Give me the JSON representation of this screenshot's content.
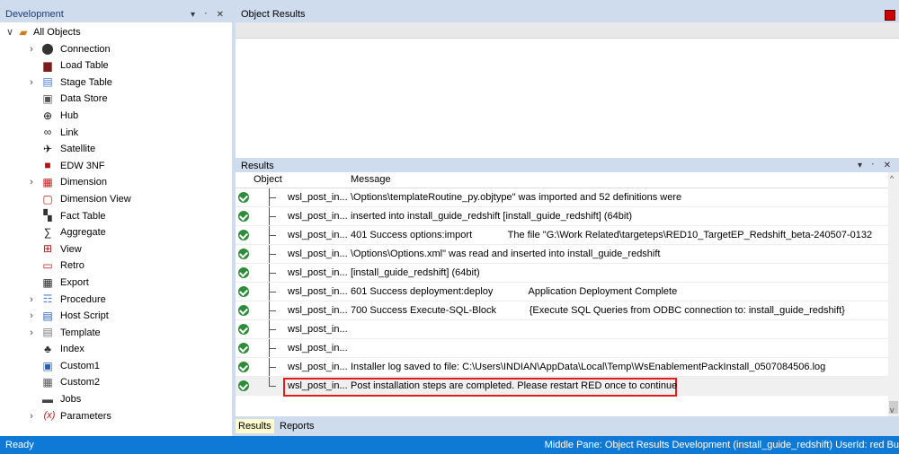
{
  "left_panel": {
    "title": "Development",
    "pin": "▾ ᛫ ✕",
    "root": "All Objects",
    "items": [
      {
        "label": "Connection",
        "arrow": ">",
        "icon": "connection-icon",
        "glyph": "⬤",
        "color": "#333"
      },
      {
        "label": "Load Table",
        "arrow": "",
        "icon": "load-table-icon",
        "glyph": "▆",
        "color": "#7a1d1d"
      },
      {
        "label": "Stage Table",
        "arrow": ">",
        "icon": "stage-table-icon",
        "glyph": "▤",
        "color": "#4b7bd1"
      },
      {
        "label": "Data Store",
        "arrow": "",
        "icon": "data-store-icon",
        "glyph": "▣",
        "color": "#555"
      },
      {
        "label": "Hub",
        "arrow": "",
        "icon": "hub-icon",
        "glyph": "⊕",
        "color": "#111"
      },
      {
        "label": "Link",
        "arrow": "",
        "icon": "link-icon",
        "glyph": "∞",
        "color": "#222"
      },
      {
        "label": "Satellite",
        "arrow": "",
        "icon": "satellite-icon",
        "glyph": "✈",
        "color": "#111"
      },
      {
        "label": "EDW 3NF",
        "arrow": "",
        "icon": "edw-icon",
        "glyph": "■",
        "color": "#b01818"
      },
      {
        "label": "Dimension",
        "arrow": ">",
        "icon": "dimension-icon",
        "glyph": "▦",
        "color": "#c01818"
      },
      {
        "label": "Dimension View",
        "arrow": "",
        "icon": "dimension-view-icon",
        "glyph": "▢",
        "color": "#c01818"
      },
      {
        "label": "Fact Table",
        "arrow": "",
        "icon": "fact-table-icon",
        "glyph": "▚",
        "color": "#333"
      },
      {
        "label": "Aggregate",
        "arrow": "",
        "icon": "aggregate-icon",
        "glyph": "∑",
        "color": "#111"
      },
      {
        "label": "View",
        "arrow": "",
        "icon": "view-icon",
        "glyph": "⊞",
        "color": "#b01818"
      },
      {
        "label": "Retro",
        "arrow": "",
        "icon": "retro-icon",
        "glyph": "▭",
        "color": "#b01818"
      },
      {
        "label": "Export",
        "arrow": "",
        "icon": "export-icon",
        "glyph": "▦",
        "color": "#222"
      },
      {
        "label": "Procedure",
        "arrow": ">",
        "icon": "procedure-icon",
        "glyph": "☶",
        "color": "#4b7bd1"
      },
      {
        "label": "Host Script",
        "arrow": ">",
        "icon": "host-script-icon",
        "glyph": "▤",
        "color": "#2b5fb0"
      },
      {
        "label": "Template",
        "arrow": ">",
        "icon": "template-icon",
        "glyph": "▤",
        "color": "#777"
      },
      {
        "label": "Index",
        "arrow": "",
        "icon": "index-icon",
        "glyph": "♣",
        "color": "#333"
      },
      {
        "label": "Custom1",
        "arrow": "",
        "icon": "custom1-icon",
        "glyph": "▣",
        "color": "#2b5fb0"
      },
      {
        "label": "Custom2",
        "arrow": "",
        "icon": "custom2-icon",
        "glyph": "▦",
        "color": "#555"
      },
      {
        "label": "Jobs",
        "arrow": "",
        "icon": "jobs-icon",
        "glyph": "▬",
        "color": "#444"
      },
      {
        "label": "Parameters",
        "arrow": ">",
        "icon": "parameters-icon",
        "glyph": "(x)",
        "color": "#b01818"
      }
    ]
  },
  "object_results": {
    "title": "Object Results"
  },
  "results": {
    "title": "Results",
    "pin": "▾ ᛫ ✕",
    "columns": [
      "Object",
      "Message"
    ],
    "rows": [
      {
        "object": "wsl_post_in...",
        "message": "\\Options\\templateRoutine_py.objtype\" was imported and 52 definitions were"
      },
      {
        "object": "wsl_post_in...",
        "message": "inserted into install_guide_redshift [install_guide_redshift] (64bit)"
      },
      {
        "object": "wsl_post_in...",
        "message": "401 Success options:import             The file \"G:\\Work Related\\targeteps\\RED10_TargetEP_Redshift_beta-240507-0132"
      },
      {
        "object": "wsl_post_in...",
        "message": "\\Options\\Options.xml\" was read and inserted into install_guide_redshift"
      },
      {
        "object": "wsl_post_in...",
        "message": "[install_guide_redshift] (64bit)"
      },
      {
        "object": "wsl_post_in...",
        "message": "601 Success deployment:deploy             Application Deployment Complete"
      },
      {
        "object": "wsl_post_in...",
        "message": "700 Success Execute-SQL-Block            {Execute SQL Queries from ODBC connection to: install_guide_redshift}"
      },
      {
        "object": "wsl_post_in...",
        "message": ""
      },
      {
        "object": "wsl_post_in...",
        "message": ""
      },
      {
        "object": "wsl_post_in...",
        "message": "Installer log saved to file: C:\\Users\\INDIAN\\AppData\\Local\\Temp\\WsEnablementPackInstall_0507084506.log"
      },
      {
        "object": "wsl_post_in...",
        "message": "Post installation steps are completed. Please restart RED once to continue"
      }
    ],
    "tabs": [
      "Results",
      "Reports"
    ]
  },
  "status": {
    "left": "Ready",
    "right": "Middle Pane: Object Results   Development (install_guide_redshift)   UserId: red   Bu"
  }
}
